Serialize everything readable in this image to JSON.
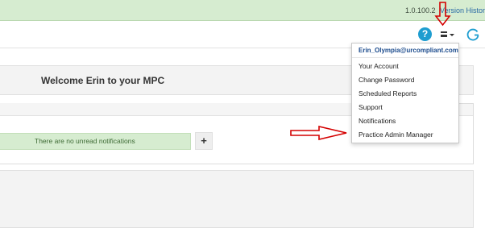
{
  "version_bar": {
    "version": "1.0.100.2",
    "history_link": "Version History"
  },
  "header": {
    "help_icon": "?",
    "icons": [
      "help-icon",
      "menu-icon",
      "refresh-icon"
    ]
  },
  "welcome": {
    "title": "Welcome Erin to your MPC"
  },
  "notifications": {
    "message": "There are no unread notifications",
    "add_label": "+"
  },
  "user_menu": {
    "email": "Erin_Olympia@urcompliant.com",
    "items": [
      "Your Account",
      "Change Password",
      "Scheduled Reports",
      "Support",
      "Notifications",
      "Practice Admin Manager"
    ]
  },
  "colors": {
    "accent": "#1e9dd0",
    "link": "#2a6aa5",
    "success_bg": "#d6ecd0",
    "annotation": "#d40000"
  }
}
